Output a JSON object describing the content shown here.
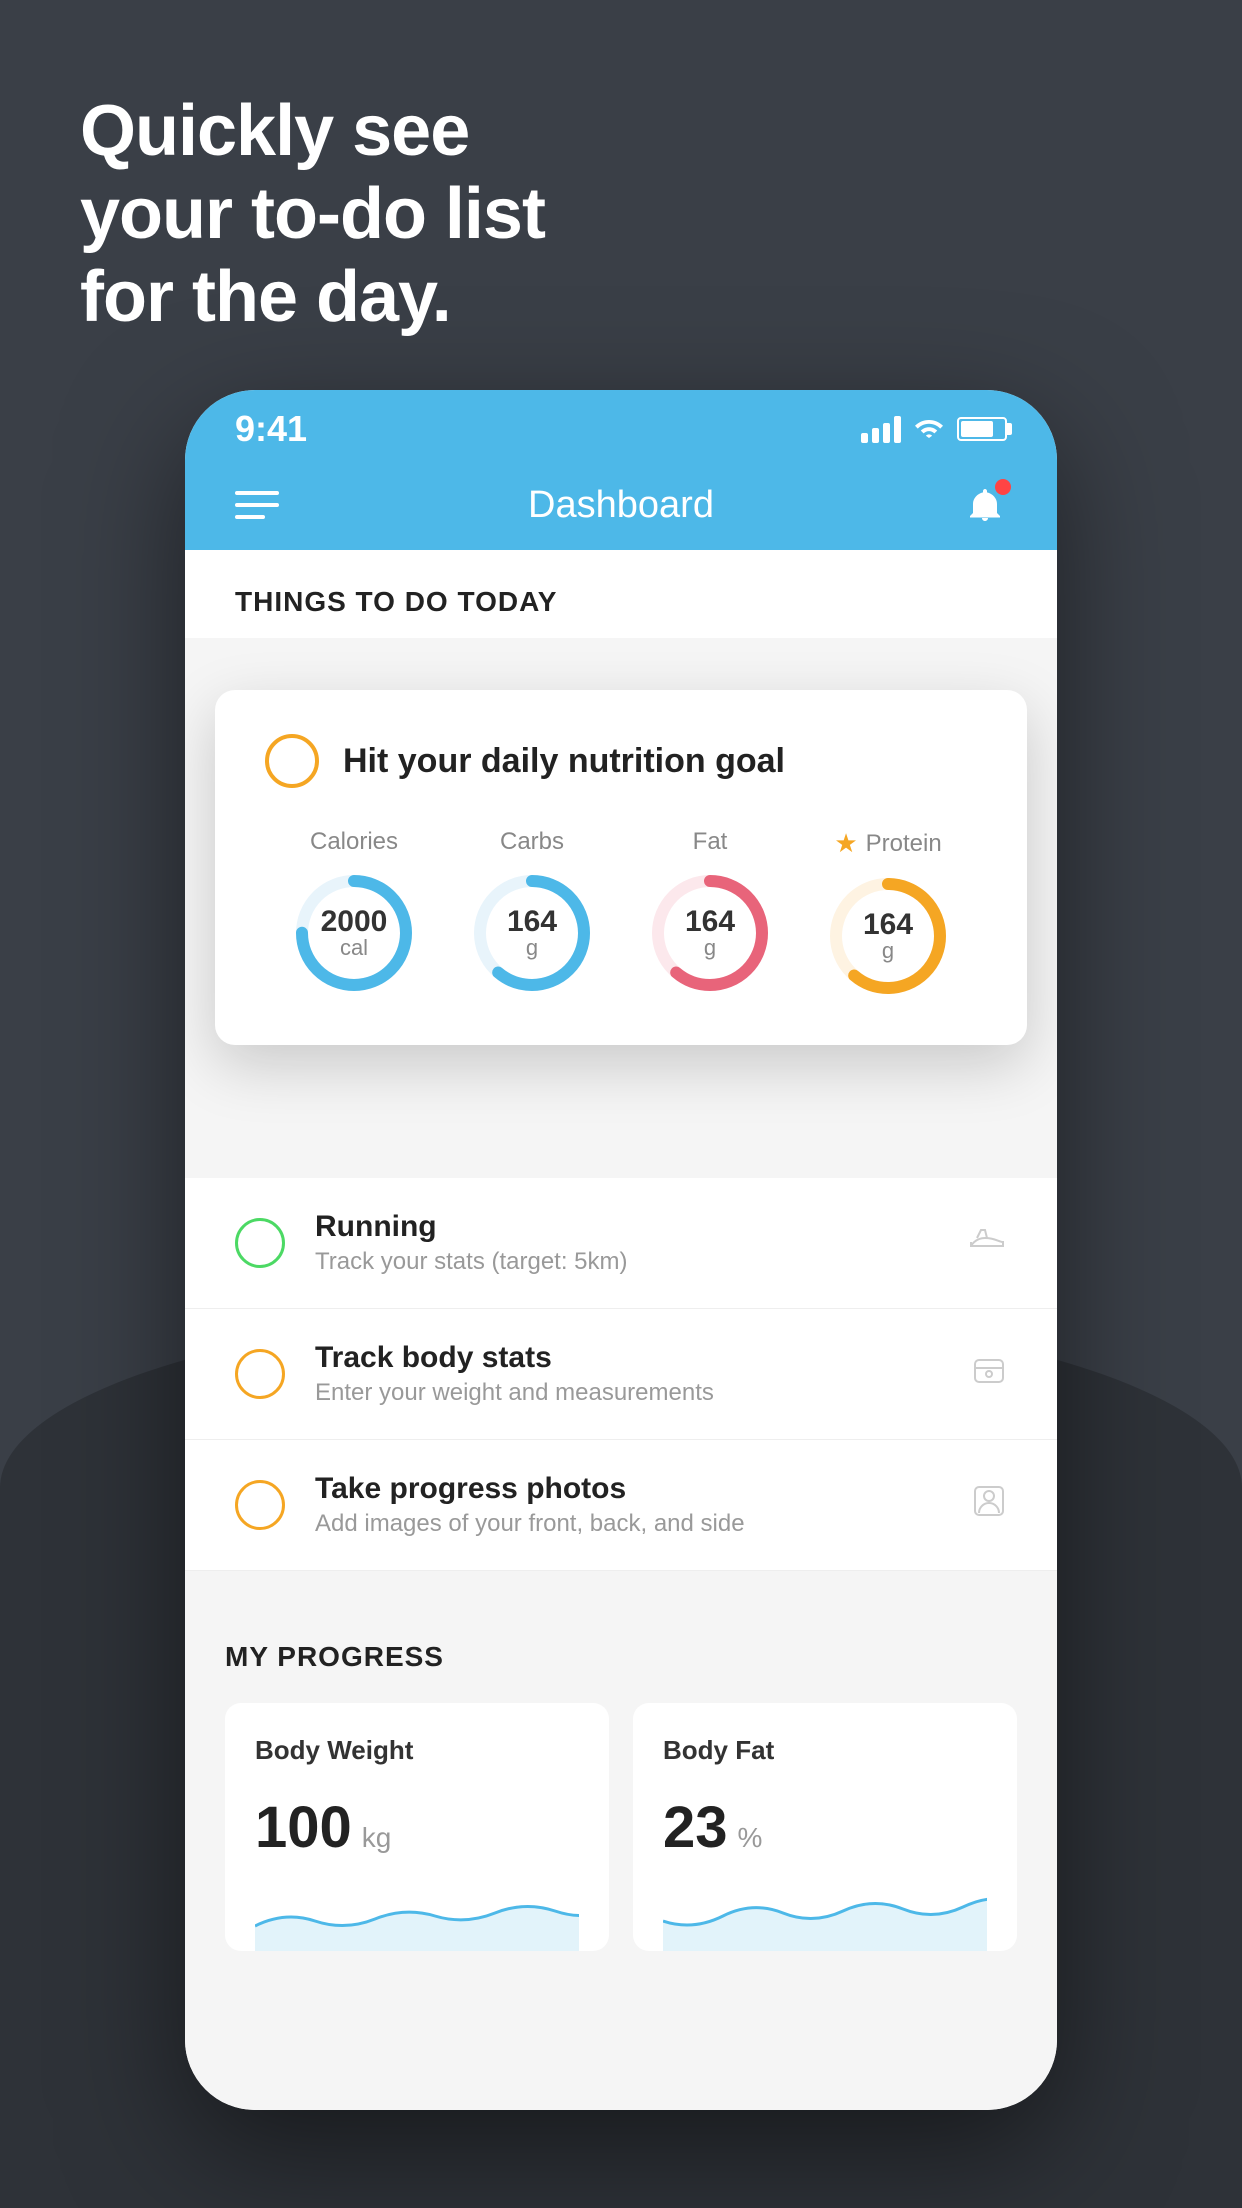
{
  "headline": {
    "line1": "Quickly see",
    "line2": "your to-do list",
    "line3": "for the day."
  },
  "status_bar": {
    "time": "9:41"
  },
  "nav": {
    "title": "Dashboard"
  },
  "section": {
    "title": "THINGS TO DO TODAY"
  },
  "nutrition_card": {
    "title": "Hit your daily nutrition goal",
    "items": [
      {
        "label": "Calories",
        "value": "2000",
        "unit": "cal",
        "color": "#4db8e8",
        "star": false
      },
      {
        "label": "Carbs",
        "value": "164",
        "unit": "g",
        "color": "#4db8e8",
        "star": false
      },
      {
        "label": "Fat",
        "value": "164",
        "unit": "g",
        "color": "#e8647a",
        "star": false
      },
      {
        "label": "Protein",
        "value": "164",
        "unit": "g",
        "color": "#f5a623",
        "star": true
      }
    ]
  },
  "todo_items": [
    {
      "name": "Running",
      "sub": "Track your stats (target: 5km)",
      "circle": "green",
      "icon": "shoe"
    },
    {
      "name": "Track body stats",
      "sub": "Enter your weight and measurements",
      "circle": "yellow",
      "icon": "scale"
    },
    {
      "name": "Take progress photos",
      "sub": "Add images of your front, back, and side",
      "circle": "yellow",
      "icon": "person"
    }
  ],
  "progress": {
    "title": "MY PROGRESS",
    "cards": [
      {
        "title": "Body Weight",
        "value": "100",
        "unit": "kg"
      },
      {
        "title": "Body Fat",
        "value": "23",
        "unit": "%"
      }
    ]
  }
}
